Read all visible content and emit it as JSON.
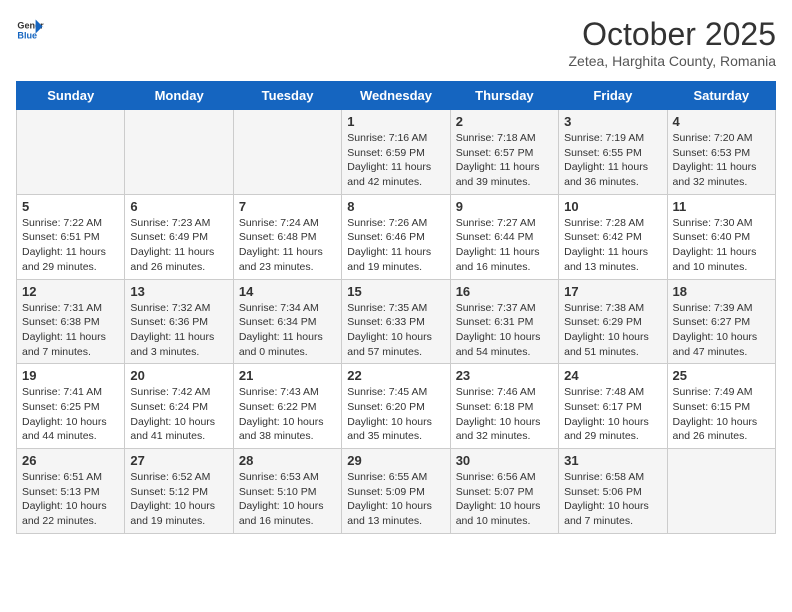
{
  "logo": {
    "general": "General",
    "blue": "Blue"
  },
  "title": "October 2025",
  "subtitle": "Zetea, Harghita County, Romania",
  "days_of_week": [
    "Sunday",
    "Monday",
    "Tuesday",
    "Wednesday",
    "Thursday",
    "Friday",
    "Saturday"
  ],
  "weeks": [
    [
      {
        "day": "",
        "info": ""
      },
      {
        "day": "",
        "info": ""
      },
      {
        "day": "",
        "info": ""
      },
      {
        "day": "1",
        "info": "Sunrise: 7:16 AM\nSunset: 6:59 PM\nDaylight: 11 hours and 42 minutes."
      },
      {
        "day": "2",
        "info": "Sunrise: 7:18 AM\nSunset: 6:57 PM\nDaylight: 11 hours and 39 minutes."
      },
      {
        "day": "3",
        "info": "Sunrise: 7:19 AM\nSunset: 6:55 PM\nDaylight: 11 hours and 36 minutes."
      },
      {
        "day": "4",
        "info": "Sunrise: 7:20 AM\nSunset: 6:53 PM\nDaylight: 11 hours and 32 minutes."
      }
    ],
    [
      {
        "day": "5",
        "info": "Sunrise: 7:22 AM\nSunset: 6:51 PM\nDaylight: 11 hours and 29 minutes."
      },
      {
        "day": "6",
        "info": "Sunrise: 7:23 AM\nSunset: 6:49 PM\nDaylight: 11 hours and 26 minutes."
      },
      {
        "day": "7",
        "info": "Sunrise: 7:24 AM\nSunset: 6:48 PM\nDaylight: 11 hours and 23 minutes."
      },
      {
        "day": "8",
        "info": "Sunrise: 7:26 AM\nSunset: 6:46 PM\nDaylight: 11 hours and 19 minutes."
      },
      {
        "day": "9",
        "info": "Sunrise: 7:27 AM\nSunset: 6:44 PM\nDaylight: 11 hours and 16 minutes."
      },
      {
        "day": "10",
        "info": "Sunrise: 7:28 AM\nSunset: 6:42 PM\nDaylight: 11 hours and 13 minutes."
      },
      {
        "day": "11",
        "info": "Sunrise: 7:30 AM\nSunset: 6:40 PM\nDaylight: 11 hours and 10 minutes."
      }
    ],
    [
      {
        "day": "12",
        "info": "Sunrise: 7:31 AM\nSunset: 6:38 PM\nDaylight: 11 hours and 7 minutes."
      },
      {
        "day": "13",
        "info": "Sunrise: 7:32 AM\nSunset: 6:36 PM\nDaylight: 11 hours and 3 minutes."
      },
      {
        "day": "14",
        "info": "Sunrise: 7:34 AM\nSunset: 6:34 PM\nDaylight: 11 hours and 0 minutes."
      },
      {
        "day": "15",
        "info": "Sunrise: 7:35 AM\nSunset: 6:33 PM\nDaylight: 10 hours and 57 minutes."
      },
      {
        "day": "16",
        "info": "Sunrise: 7:37 AM\nSunset: 6:31 PM\nDaylight: 10 hours and 54 minutes."
      },
      {
        "day": "17",
        "info": "Sunrise: 7:38 AM\nSunset: 6:29 PM\nDaylight: 10 hours and 51 minutes."
      },
      {
        "day": "18",
        "info": "Sunrise: 7:39 AM\nSunset: 6:27 PM\nDaylight: 10 hours and 47 minutes."
      }
    ],
    [
      {
        "day": "19",
        "info": "Sunrise: 7:41 AM\nSunset: 6:25 PM\nDaylight: 10 hours and 44 minutes."
      },
      {
        "day": "20",
        "info": "Sunrise: 7:42 AM\nSunset: 6:24 PM\nDaylight: 10 hours and 41 minutes."
      },
      {
        "day": "21",
        "info": "Sunrise: 7:43 AM\nSunset: 6:22 PM\nDaylight: 10 hours and 38 minutes."
      },
      {
        "day": "22",
        "info": "Sunrise: 7:45 AM\nSunset: 6:20 PM\nDaylight: 10 hours and 35 minutes."
      },
      {
        "day": "23",
        "info": "Sunrise: 7:46 AM\nSunset: 6:18 PM\nDaylight: 10 hours and 32 minutes."
      },
      {
        "day": "24",
        "info": "Sunrise: 7:48 AM\nSunset: 6:17 PM\nDaylight: 10 hours and 29 minutes."
      },
      {
        "day": "25",
        "info": "Sunrise: 7:49 AM\nSunset: 6:15 PM\nDaylight: 10 hours and 26 minutes."
      }
    ],
    [
      {
        "day": "26",
        "info": "Sunrise: 6:51 AM\nSunset: 5:13 PM\nDaylight: 10 hours and 22 minutes."
      },
      {
        "day": "27",
        "info": "Sunrise: 6:52 AM\nSunset: 5:12 PM\nDaylight: 10 hours and 19 minutes."
      },
      {
        "day": "28",
        "info": "Sunrise: 6:53 AM\nSunset: 5:10 PM\nDaylight: 10 hours and 16 minutes."
      },
      {
        "day": "29",
        "info": "Sunrise: 6:55 AM\nSunset: 5:09 PM\nDaylight: 10 hours and 13 minutes."
      },
      {
        "day": "30",
        "info": "Sunrise: 6:56 AM\nSunset: 5:07 PM\nDaylight: 10 hours and 10 minutes."
      },
      {
        "day": "31",
        "info": "Sunrise: 6:58 AM\nSunset: 5:06 PM\nDaylight: 10 hours and 7 minutes."
      },
      {
        "day": "",
        "info": ""
      }
    ]
  ]
}
